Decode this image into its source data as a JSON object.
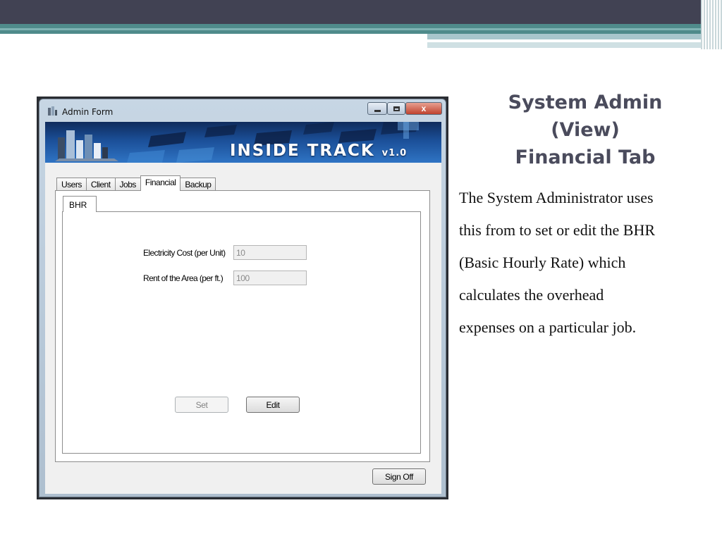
{
  "slide": {
    "title_lines": [
      "System Admin",
      "(View)",
      "Financial Tab"
    ],
    "body_lines": [
      "The System Administrator uses",
      "this from to set or edit the BHR",
      "(Basic Hourly Rate) which",
      "calculates the overhead",
      "expenses on a particular job."
    ]
  },
  "window": {
    "title": "Admin Form",
    "banner": {
      "brand": "INSIDE TRACK",
      "version": "v1.0"
    },
    "tabs": [
      "Users",
      "Client",
      "Jobs",
      "Financial",
      "Backup"
    ],
    "active_tab": "Financial",
    "subtab": "BHR",
    "fields": [
      {
        "label": "Electricity Cost (per Unit)",
        "value": "10"
      },
      {
        "label": "Rent of the Area (per ft.)",
        "value": "100"
      }
    ],
    "buttons": {
      "set": "Set",
      "edit": "Edit",
      "sign_off": "Sign Off"
    },
    "controls": {
      "close_glyph": "x"
    }
  },
  "colors": {
    "topbar": "#414253",
    "teal": "#4f8b8b",
    "title_text": "#4a4b5c",
    "banner_blue": "#1b4f98"
  }
}
